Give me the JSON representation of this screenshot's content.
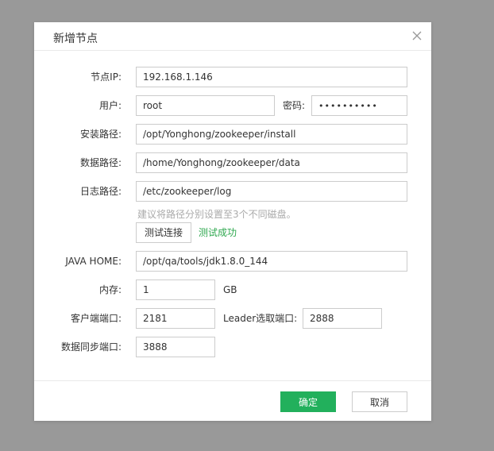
{
  "dialog": {
    "title": "新增节点",
    "close_icon": "close-icon"
  },
  "form": {
    "ip": {
      "label": "节点IP:",
      "value": "192.168.1.146"
    },
    "user": {
      "label": "用户:",
      "value": "root"
    },
    "password": {
      "label": "密码:",
      "value": "••••••••••"
    },
    "install_path": {
      "label": "安装路径:",
      "value": "/opt/Yonghong/zookeeper/install"
    },
    "data_path": {
      "label": "数据路径:",
      "value": "/home/Yonghong/zookeeper/data"
    },
    "log_path": {
      "label": "日志路径:",
      "value": "/etc/zookeeper/log"
    },
    "hint": "建议将路径分别设置至3个不同磁盘。",
    "test_button": "测试连接",
    "test_result": "测试成功",
    "java_home": {
      "label": "JAVA HOME:",
      "value": "/opt/qa/tools/jdk1.8.0_144"
    },
    "memory": {
      "label": "内存:",
      "value": "1",
      "unit": "GB"
    },
    "client_port": {
      "label": "客户端端口:",
      "value": "2181"
    },
    "leader_port": {
      "label": "Leader选取端口:",
      "value": "2888"
    },
    "sync_port": {
      "label": "数据同步端口:",
      "value": "3888"
    }
  },
  "footer": {
    "confirm": "确定",
    "cancel": "取消"
  },
  "colors": {
    "primary": "#22b05c",
    "success_text": "#2fa84f",
    "overlay": "#999999"
  }
}
